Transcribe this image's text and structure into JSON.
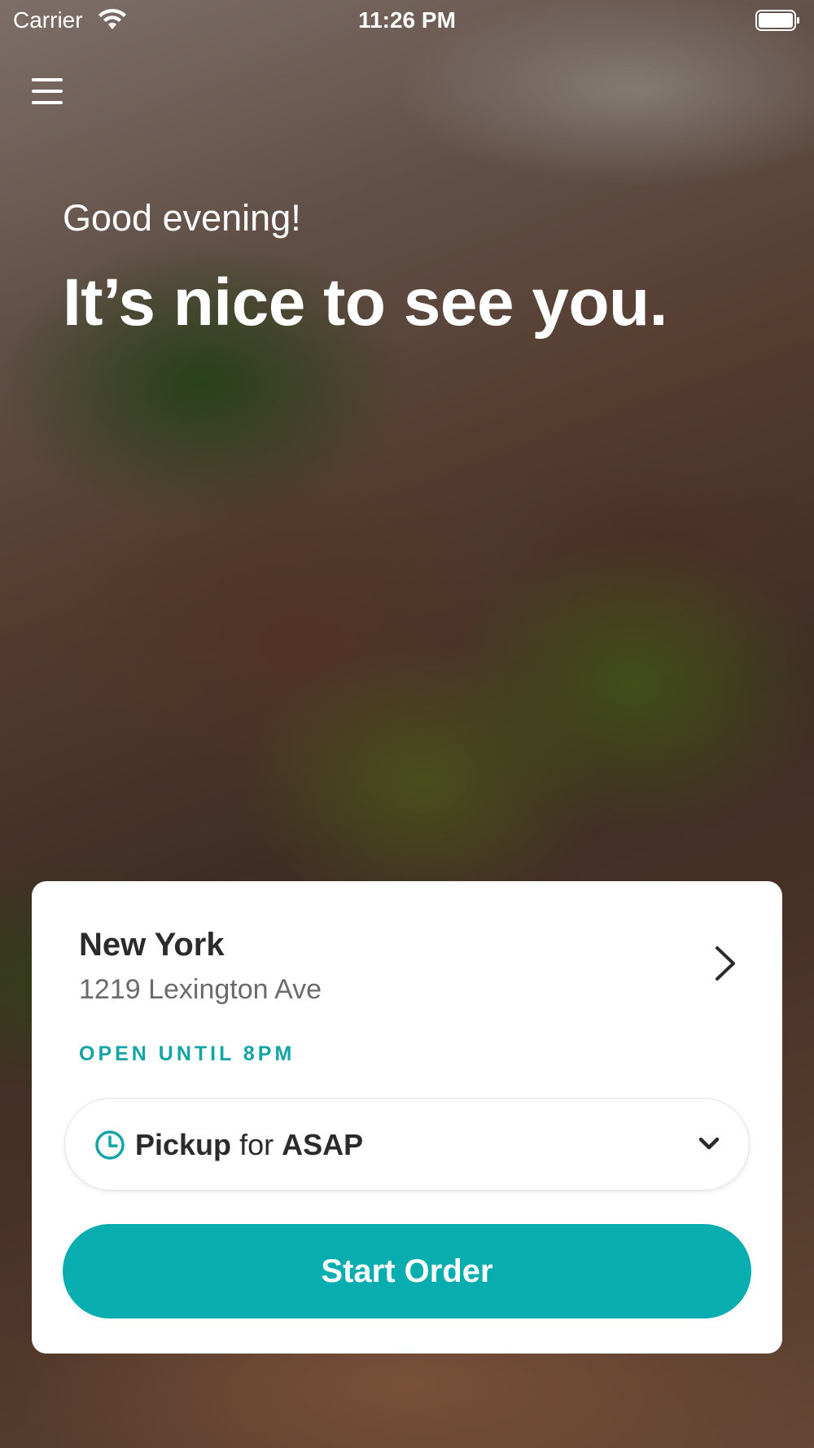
{
  "status_bar": {
    "carrier": "Carrier",
    "time": "11:26 PM"
  },
  "menu": {
    "icon": "hamburger-menu-icon"
  },
  "hero": {
    "greeting": "Good evening!",
    "headline": "It’s nice to see you."
  },
  "location": {
    "name": "New York",
    "address": "1219 Lexington Ave",
    "status": "OPEN UNTIL 8PM"
  },
  "order_mode": {
    "mode": "Pickup",
    "connector": "for",
    "time": "ASAP"
  },
  "actions": {
    "start_order": "Start Order"
  },
  "colors": {
    "accent": "#07adaf",
    "status_text": "#12a4a6"
  }
}
